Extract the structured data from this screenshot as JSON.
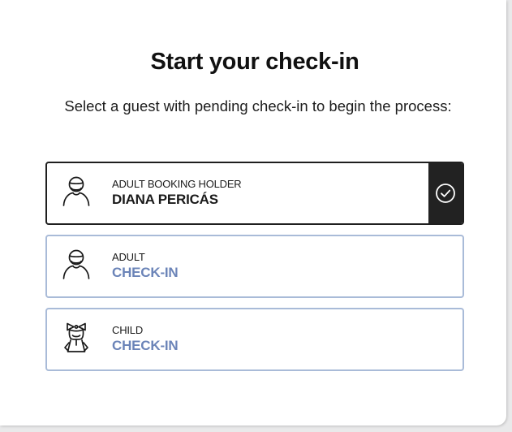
{
  "header": {
    "title": "Start your check-in",
    "subtitle": "Select a guest with pending check-in to begin the process:"
  },
  "guests": [
    {
      "role": "ADULT BOOKING HOLDER",
      "text": "DIANA PERICÁS",
      "icon": "adult-icon",
      "selected": true
    },
    {
      "role": "ADULT",
      "text": "CHECK-IN",
      "icon": "adult-icon",
      "selected": false
    },
    {
      "role": "CHILD",
      "text": "CHECK-IN",
      "icon": "child-icon",
      "selected": false
    }
  ],
  "colors": {
    "selected_border": "#1f1f1f",
    "default_border": "#a9bbd8",
    "action_text": "#6b84b8",
    "check_tab": "#222222"
  }
}
